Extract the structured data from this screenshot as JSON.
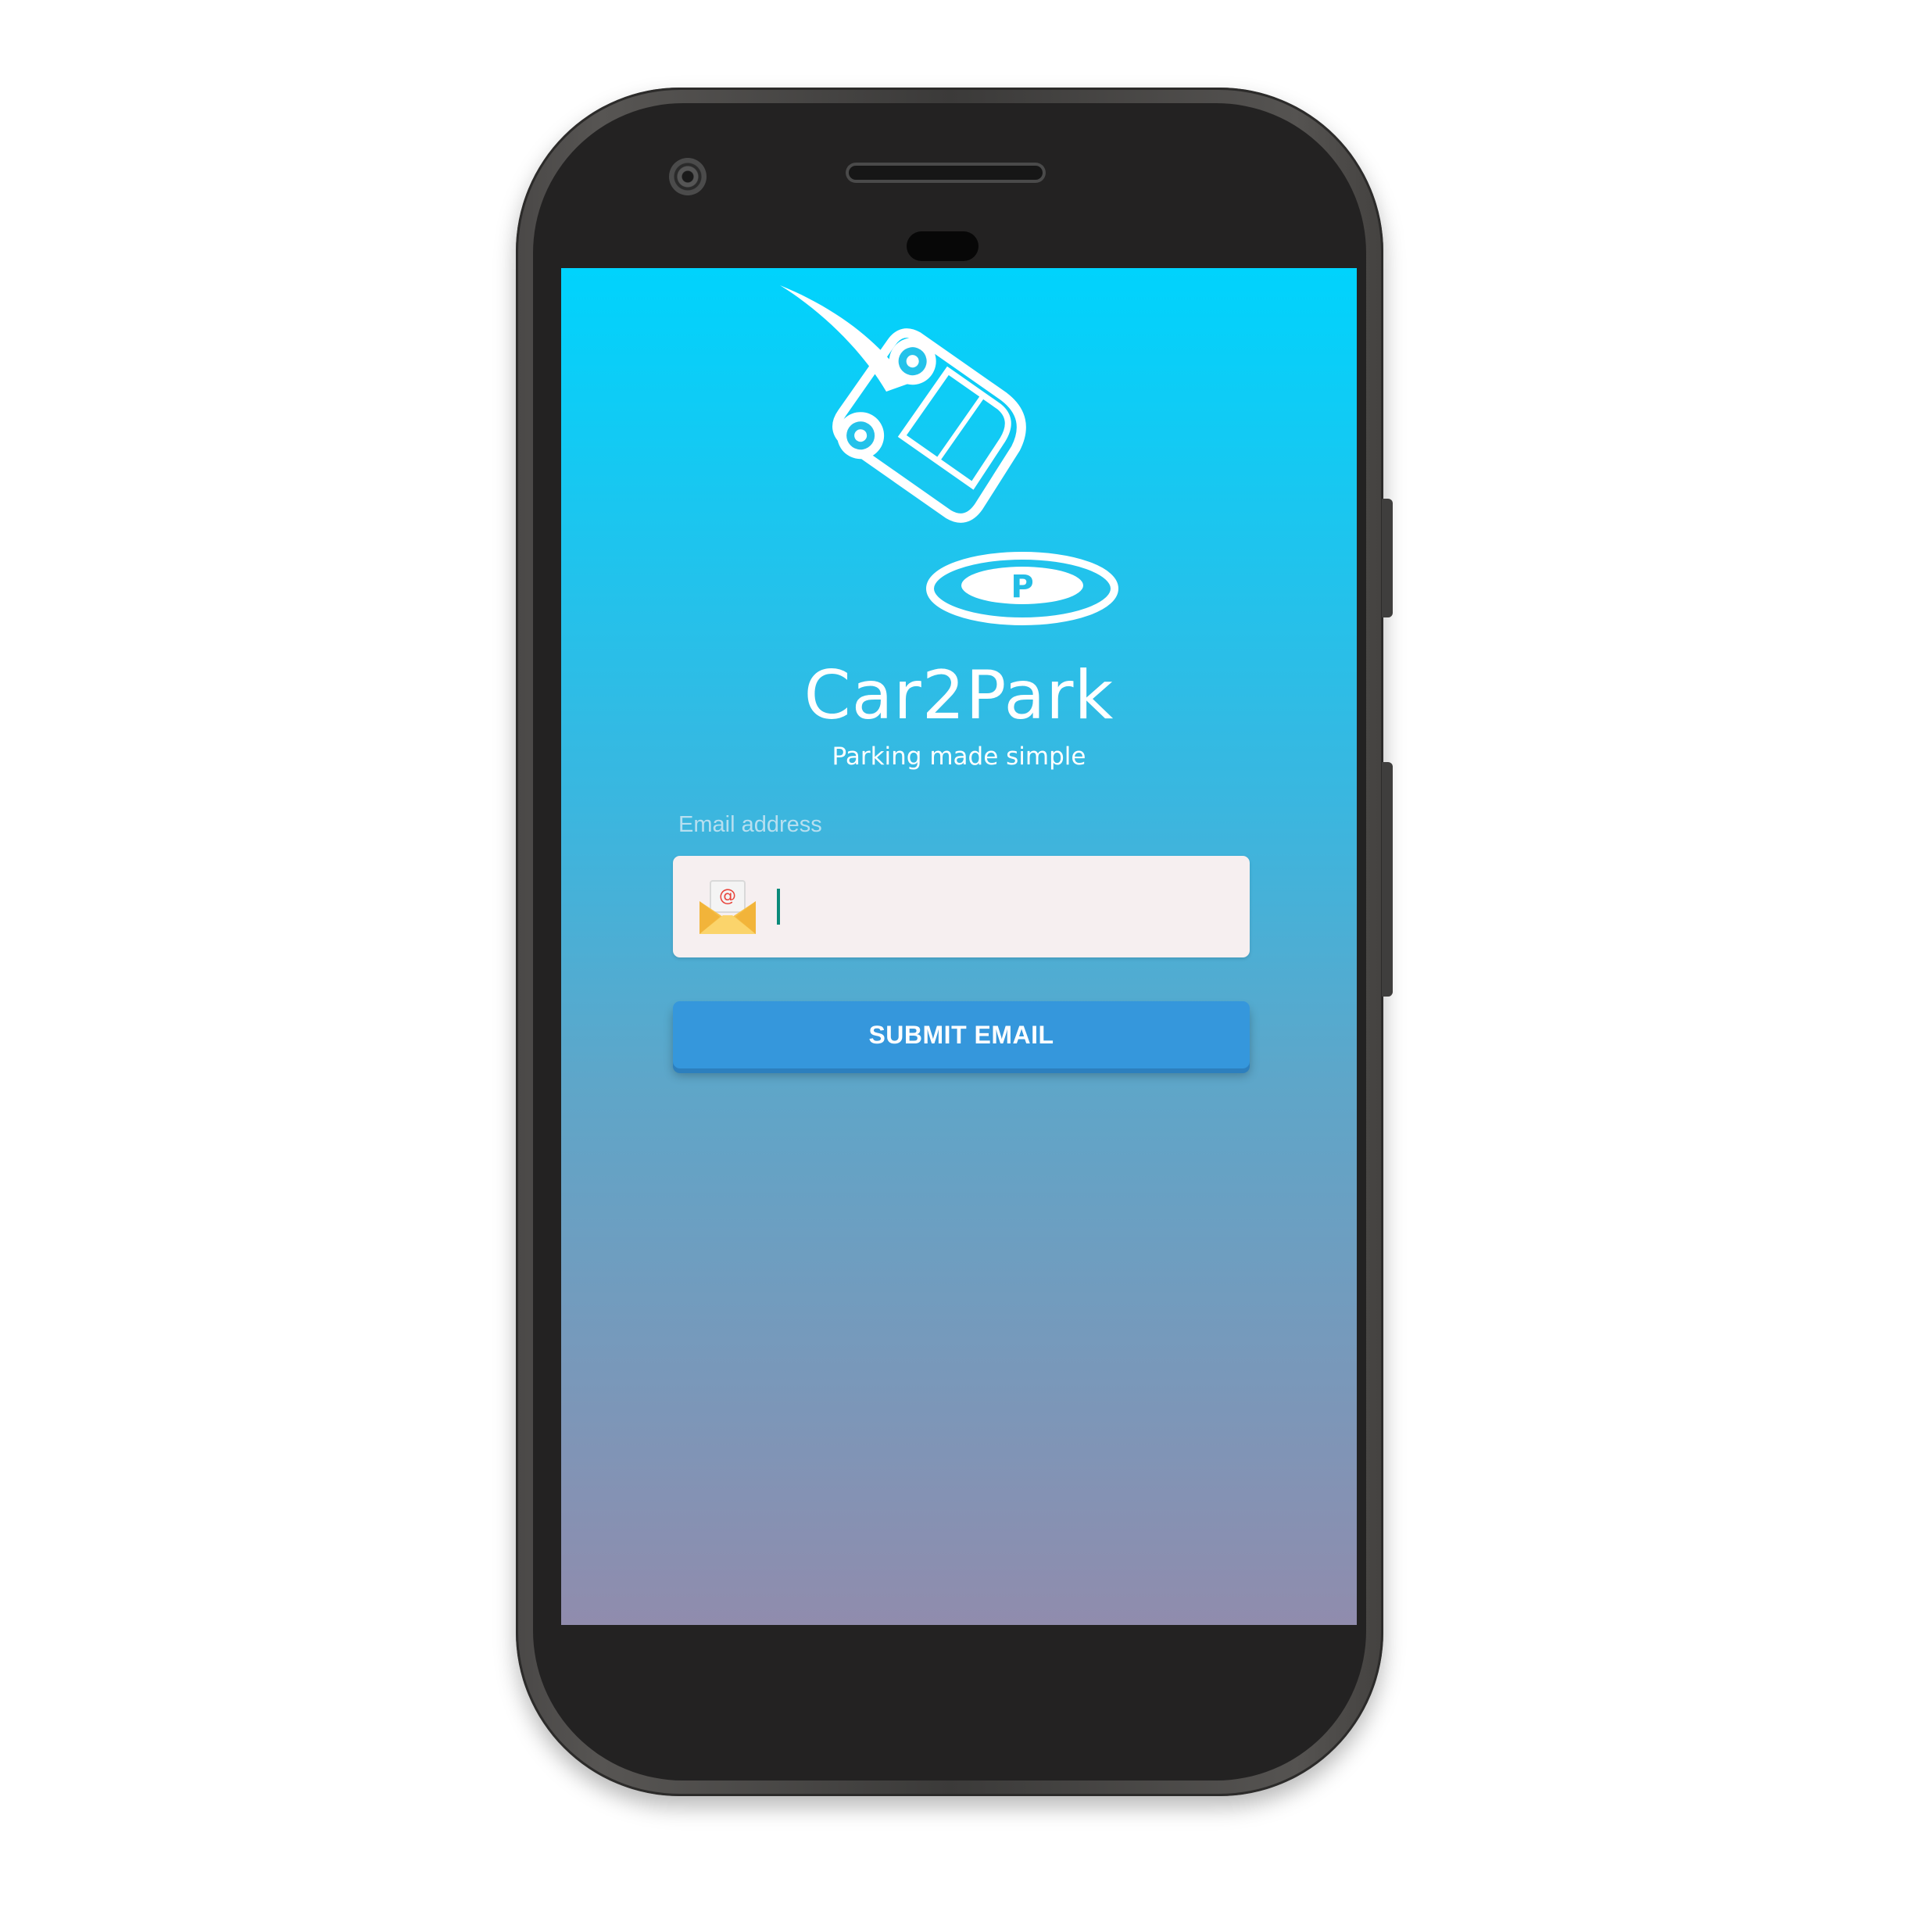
{
  "app": {
    "title": "Car2Park",
    "subtitle": "Parking made simple",
    "logo_letter": "P"
  },
  "form": {
    "email_label": "Email address",
    "email_value": "",
    "email_placeholder": "",
    "submit_label": "SUBMIT EMAIL"
  },
  "icons": {
    "logo": "car-parking-logo-icon",
    "email": "envelope-at-icon",
    "camera": "front-camera-icon"
  },
  "colors": {
    "screen_top": "#00d3fd",
    "screen_bottom": "#908cad",
    "button": "#3597dc",
    "field_bg": "#f6eff0",
    "caret": "#0a8a7a"
  }
}
